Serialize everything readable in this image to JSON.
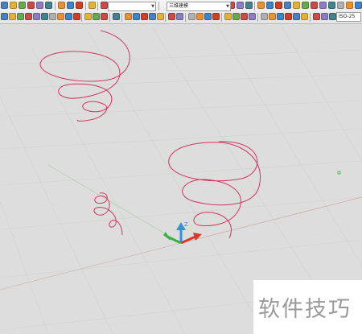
{
  "toolbar": {
    "workspace_value": "三维建模",
    "last_field_value": "ISO-25"
  },
  "viewport": {
    "helix_color": "#d3365f",
    "axis_colors": {
      "x": "#d63a2f",
      "y": "#3cb044",
      "z": "#3a8fd6"
    },
    "ucs_z_label": "Z"
  },
  "watermark": {
    "text": "软件技巧"
  }
}
